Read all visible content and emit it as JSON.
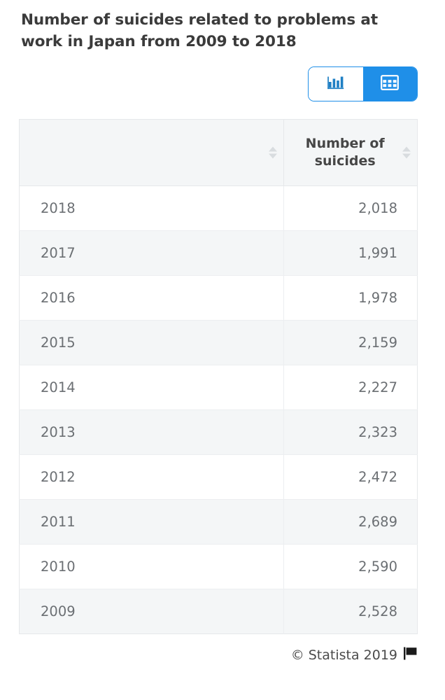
{
  "page_title": "Number of suicides related to problems at work in Japan from 2009 to 2018",
  "view_toggle": {
    "chart_button_label": "chart-view",
    "chart_icon": "bar-chart-icon",
    "table_button_label": "table-view",
    "table_icon": "table-grid-icon",
    "active": "table",
    "accent_color": "#1f8fe8"
  },
  "table": {
    "headers": {
      "label": "",
      "value": "Number of suicides"
    },
    "rows": [
      {
        "label": "2018",
        "value": "2,018"
      },
      {
        "label": "2017",
        "value": "1,991"
      },
      {
        "label": "2016",
        "value": "1,978"
      },
      {
        "label": "2015",
        "value": "2,159"
      },
      {
        "label": "2014",
        "value": "2,227"
      },
      {
        "label": "2013",
        "value": "2,323"
      },
      {
        "label": "2012",
        "value": "2,472"
      },
      {
        "label": "2011",
        "value": "2,689"
      },
      {
        "label": "2010",
        "value": "2,590"
      },
      {
        "label": "2009",
        "value": "2,528"
      }
    ]
  },
  "footer": {
    "copyright": "© Statista 2019",
    "flag_icon": "flag-icon",
    "flag_glyph": "⚑"
  },
  "chart_data": {
    "type": "table",
    "title": "Number of suicides related to problems at work in Japan from 2009 to 2018",
    "xlabel": "",
    "ylabel": "Number of suicides",
    "categories": [
      "2018",
      "2017",
      "2016",
      "2015",
      "2014",
      "2013",
      "2012",
      "2011",
      "2010",
      "2009"
    ],
    "values": [
      2018,
      1991,
      1978,
      2159,
      2227,
      2323,
      2472,
      2689,
      2590,
      2528
    ],
    "columns": [
      "",
      "Number of suicides"
    ],
    "source": "© Statista 2019"
  }
}
